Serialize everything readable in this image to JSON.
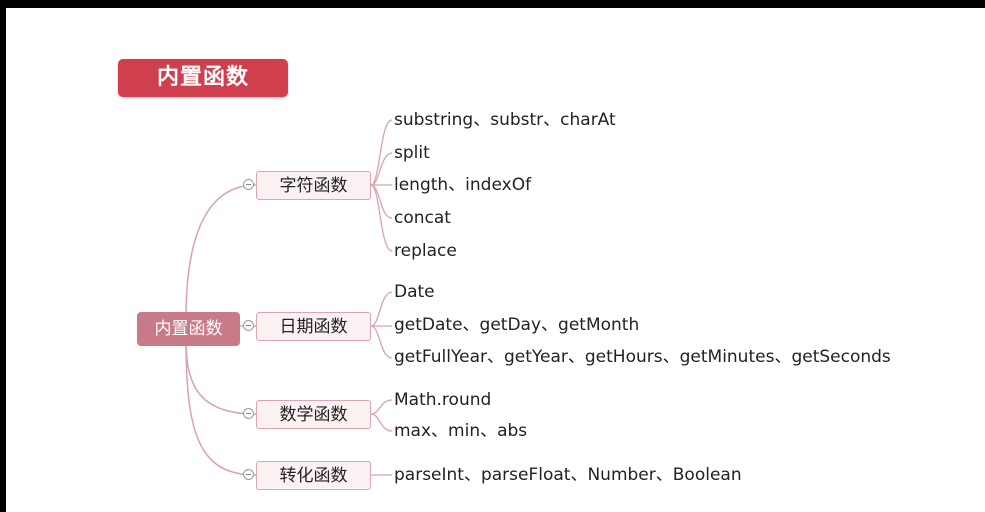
{
  "title": "内置函数",
  "mindmap": {
    "root": "内置函数",
    "branches": [
      {
        "label": "字符函数",
        "items": [
          "substring、substr、charAt",
          "split",
          "length、indexOf",
          "concat",
          "replace"
        ]
      },
      {
        "label": "日期函数",
        "items": [
          "Date",
          "getDate、getDay、getMonth",
          "getFullYear、getYear、getHours、getMinutes、getSeconds"
        ]
      },
      {
        "label": "数学函数",
        "items": [
          " Math.round",
          "max、min、abs"
        ]
      },
      {
        "label": "转化函数",
        "items": [
          "parseInt、parseFloat、Number、Boolean"
        ]
      }
    ]
  },
  "colors": {
    "title_banner": "#d03f4d",
    "root_node": "#c97a88",
    "branch_fill": "#fbf1f2",
    "branch_border": "#dca6ae",
    "connector": "#d9a3ab"
  }
}
